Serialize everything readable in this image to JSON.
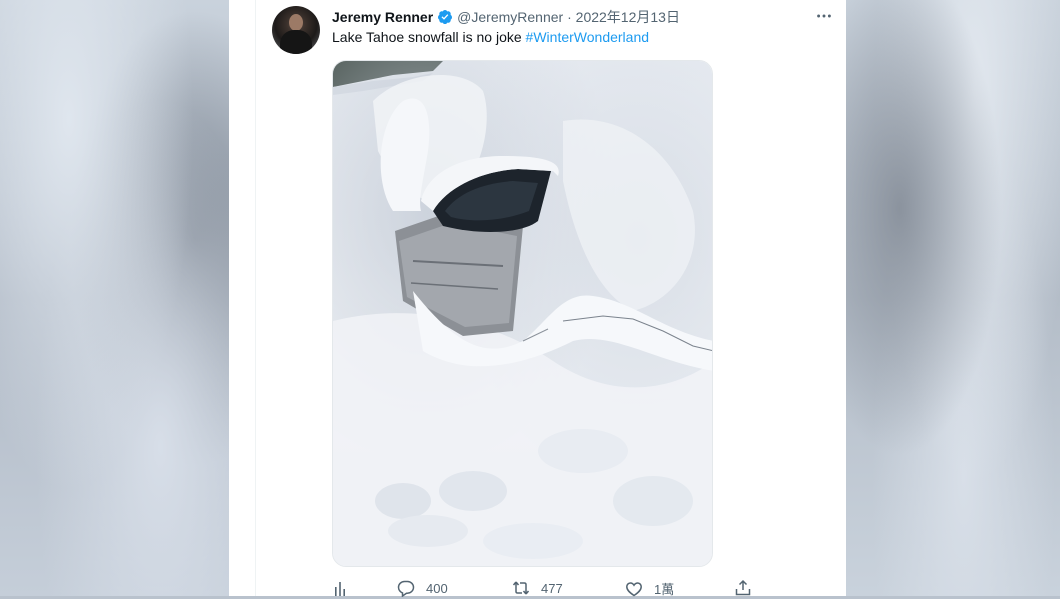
{
  "tweet": {
    "display_name": "Jeremy Renner",
    "handle": "@JeremyRenner",
    "separator": "·",
    "date": "2022年12月13日",
    "text": "Lake Tahoe snowfall is no joke ",
    "hashtag": "#WinterWonderland"
  },
  "actions": {
    "replies": "400",
    "retweets": "477",
    "likes": "1萬"
  },
  "icons": [
    "verified-icon",
    "more-icon",
    "views-icon",
    "reply-icon",
    "retweet-icon",
    "like-icon",
    "share-icon"
  ],
  "colors": {
    "link": "#1d9bf0",
    "verified": "#1d9bf0",
    "text": "#0f1419",
    "secondary": "#536471"
  }
}
